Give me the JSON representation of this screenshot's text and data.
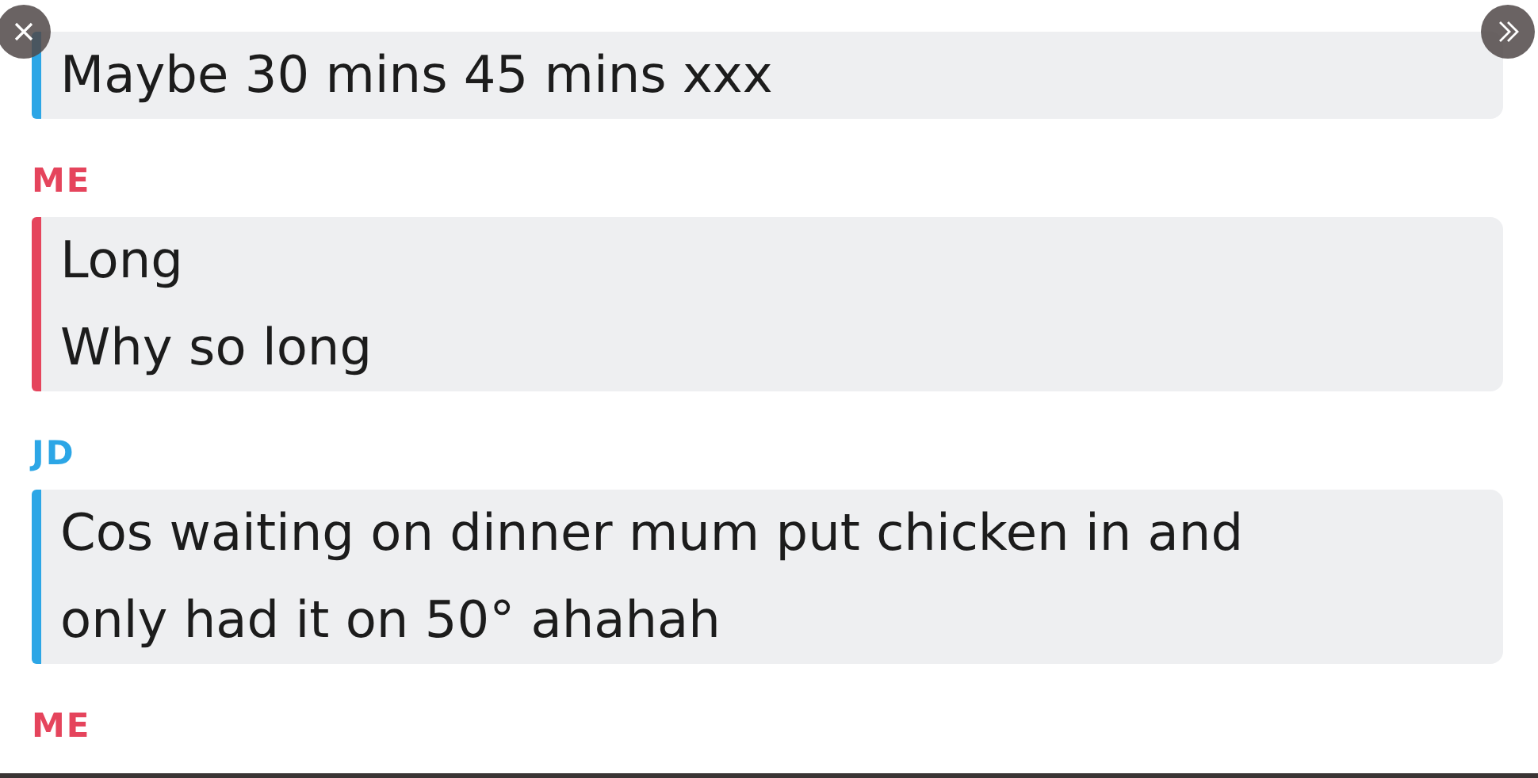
{
  "messages": [
    {
      "kind": "friend",
      "lines": [
        "Maybe 30 mins 45 mins xxx"
      ]
    },
    {
      "sender": "ME",
      "kind": "me",
      "lines": [
        "Long",
        "Why so long"
      ]
    },
    {
      "sender": "JD",
      "kind": "friend",
      "lines": [
        "Cos waiting on dinner mum put chicken in and",
        "only had it on 50° ahahah"
      ]
    },
    {
      "sender": "ME",
      "kind": "me"
    }
  ]
}
